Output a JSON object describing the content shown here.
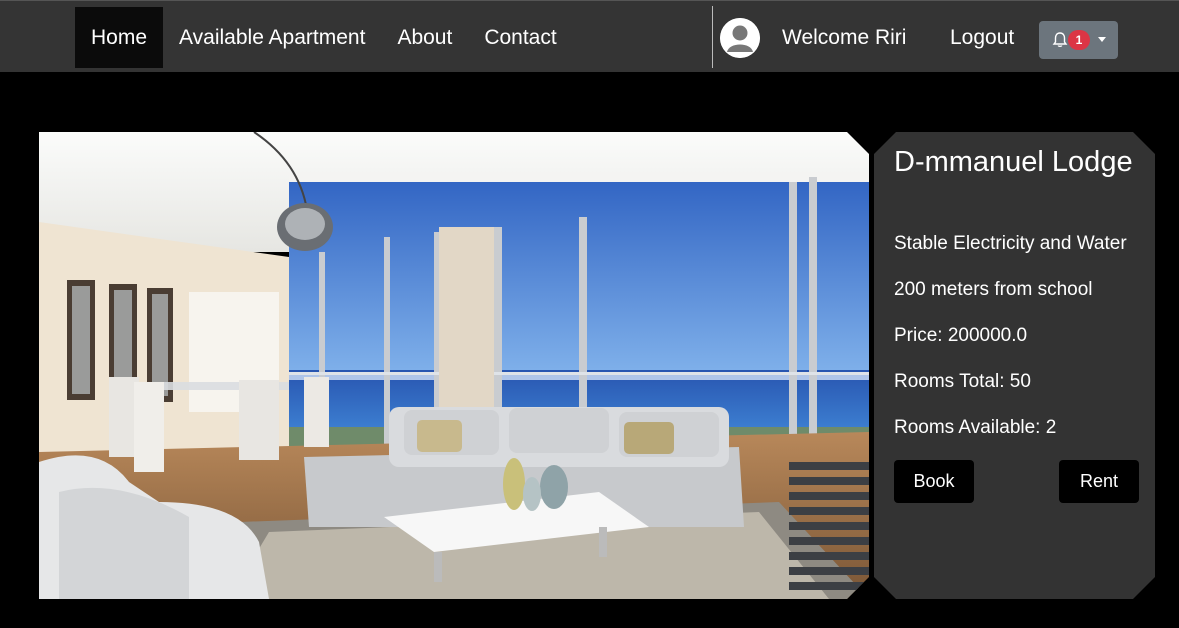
{
  "nav": {
    "links": [
      "Home",
      "Available Apartment",
      "About",
      "Contact"
    ],
    "welcome": "Welcome Riri",
    "logout": "Logout",
    "notification_count": "1",
    "icons": [
      "user-avatar-icon",
      "bell-icon",
      "caret-down-icon"
    ]
  },
  "listing": {
    "name": "D-mmanuel Lodge",
    "feature_1": "Stable Electricity and Water",
    "feature_2": "200 meters from school",
    "price": "Price: 200000.0",
    "rooms_total": "Rooms Total: 50",
    "rooms_available": "Rooms Available: 2",
    "book_label": "Book",
    "rent_label": "Rent"
  },
  "colors": {
    "navbar": "#343434",
    "page": "#000000",
    "card": "#333333",
    "badge": "#dc3545",
    "notif_button": "#6c757d"
  }
}
